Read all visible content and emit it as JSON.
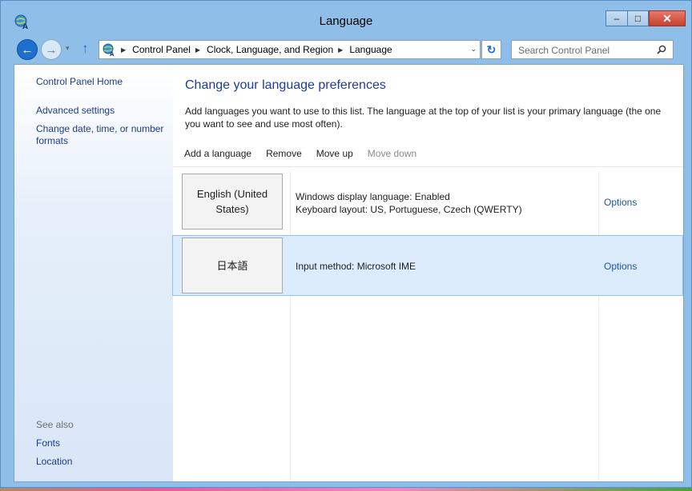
{
  "window": {
    "title": "Language",
    "minimize_glyph": "–",
    "maximize_glyph": "□",
    "close_glyph": "✕"
  },
  "navigation": {
    "back_glyph": "←",
    "forward_glyph": "→",
    "dropdown_glyph": "▾",
    "up_glyph": "↑",
    "refresh_glyph": "↻",
    "breadcrumbs": [
      "Control Panel",
      "Clock, Language, and Region",
      "Language"
    ],
    "separator_glyph": "▶",
    "address_dropdown_glyph": "⌄",
    "search": {
      "placeholder": "Search Control Panel",
      "value": ""
    }
  },
  "left_pane": {
    "links": [
      "Control Panel Home",
      "Advanced settings",
      "Change date, time, or number formats"
    ],
    "see_also_label": "See also",
    "see_also_links": [
      "Fonts",
      "Location"
    ]
  },
  "main": {
    "heading": "Change your language preferences",
    "description": "Add languages you want to use to this list. The language at the top of your list is your primary language (the one you want to see and use most often).",
    "toolbar": {
      "add": "Add a language",
      "remove": "Remove",
      "move_up": "Move up",
      "move_down": "Move down"
    },
    "languages": [
      {
        "name": "English (United States)",
        "info_line1": "Windows display language: Enabled",
        "info_line2": "Keyboard layout: US, Portuguese, Czech (QWERTY)",
        "options": "Options",
        "selected": false
      },
      {
        "name": "日本語",
        "info_line1": "Input method: Microsoft IME",
        "info_line2": "",
        "options": "Options",
        "selected": true
      }
    ]
  },
  "colors": {
    "link": "#1c3c84",
    "heading": "#1e3d9a",
    "selection": "#dcecfc",
    "frame": "#8fbfe8"
  }
}
